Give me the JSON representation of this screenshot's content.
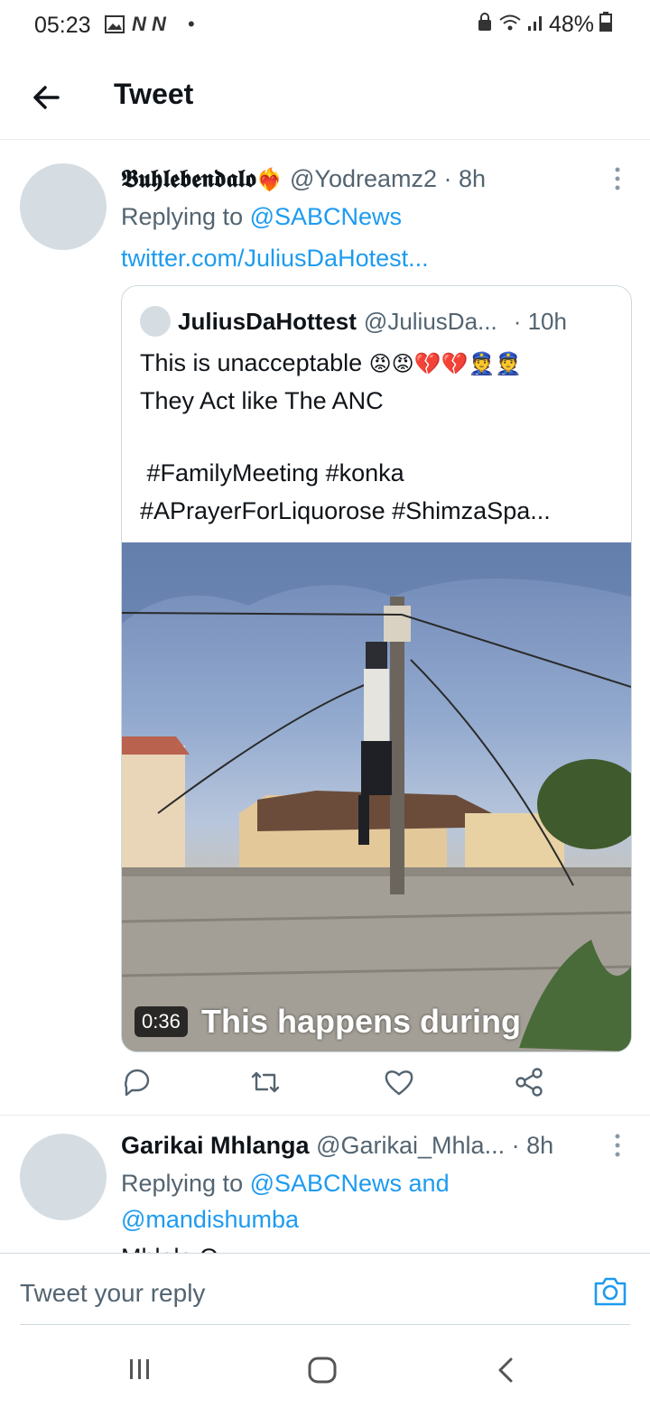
{
  "status": {
    "time": "05:23",
    "battery": "48%",
    "notif_letters": "N N",
    "dot": "•"
  },
  "header": {
    "title": "Tweet"
  },
  "tweet1": {
    "display_name": "𝕭𝖚𝖍𝖑𝖊𝖇𝖊𝖓𝖉𝖆𝖑𝖔",
    "emoji": "❤️‍🔥",
    "handle_time": "@Yodreamz2 · 8h",
    "replying_prefix": "Replying to ",
    "replying_to": "@SABCNews",
    "link": "twitter.com/JuliusDaHotest...",
    "quote": {
      "name": "JuliusDaHottest",
      "handle": "@JuliusDa...",
      "time": "· 10h",
      "line1_text": "This is unacceptable ",
      "line1_emoji": "😡😡💔💔👮👮",
      "line2": "They Act like The ANC",
      "line3": " #FamilyMeeting #konka",
      "line4": "#APrayerForLiquorose #ShimzaSpa...",
      "video_duration": "0:36",
      "video_caption": "This happens during"
    }
  },
  "tweet2": {
    "display_name": "Garikai Mhlanga",
    "handle": "@Garikai_Mhla...",
    "time": "· 8h",
    "replying_prefix": "Replying to ",
    "replying_to1": "@SABCNews and",
    "replying_to2": "@mandishumba",
    "cut_text": "Mhlala O..."
  },
  "reply_bar": {
    "placeholder": "Tweet your reply"
  },
  "icons": {
    "back": "arrow-left-icon",
    "more": "more-vertical-icon",
    "reply": "reply-icon",
    "retweet": "retweet-icon",
    "like": "heart-icon",
    "share": "share-icon",
    "camera": "camera-icon",
    "recents": "recents-icon",
    "home": "home-icon",
    "navback": "nav-back-icon"
  },
  "colors": {
    "link": "#1d9bf0",
    "muted": "#536471",
    "border": "#cfd9de"
  }
}
